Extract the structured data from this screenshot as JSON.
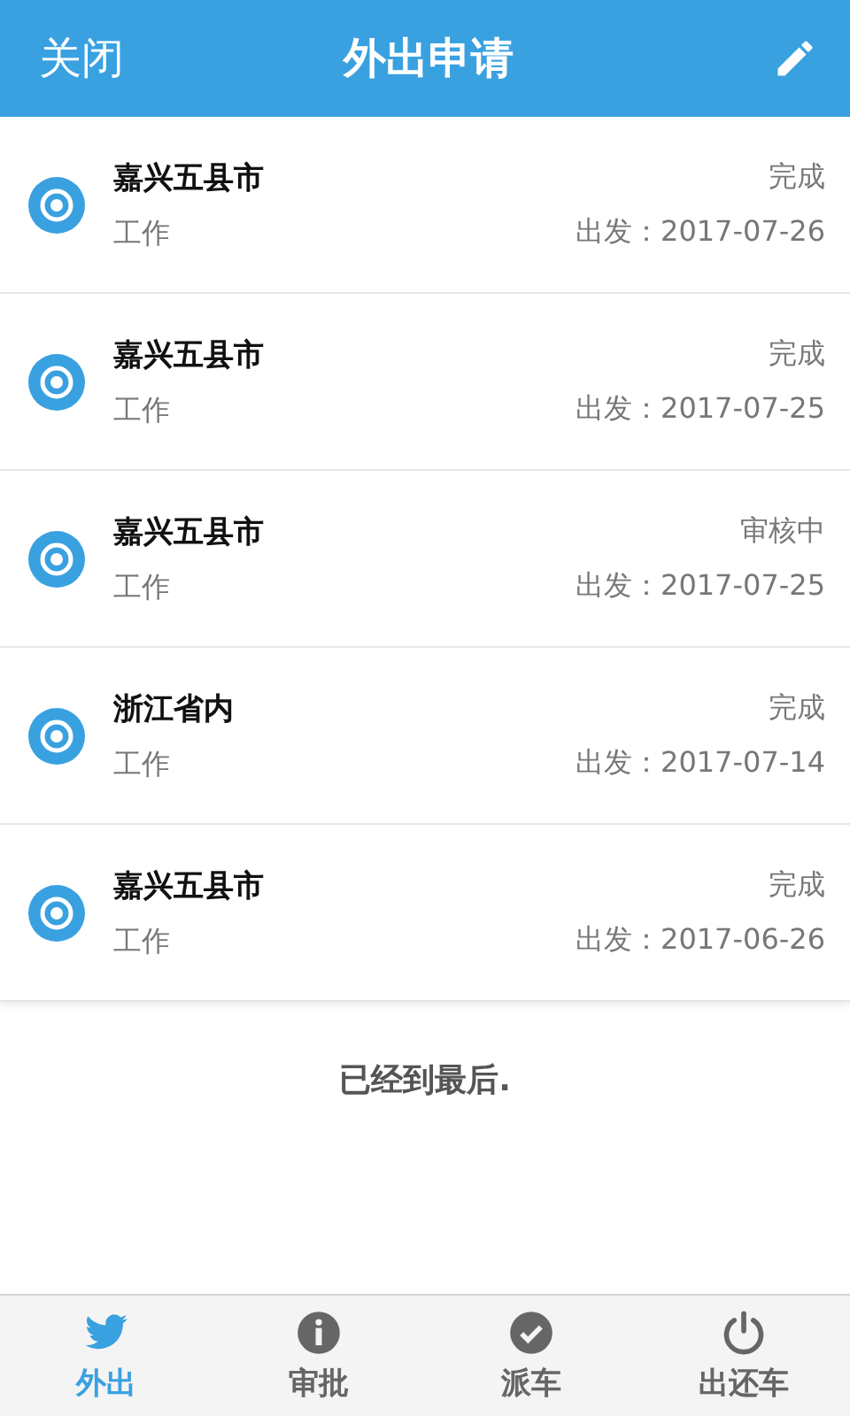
{
  "header": {
    "close": "关闭",
    "title": "外出申请"
  },
  "items": [
    {
      "destination": "嘉兴五县市",
      "type": "工作",
      "status": "完成",
      "departure": "出发：2017-07-26"
    },
    {
      "destination": "嘉兴五县市",
      "type": "工作",
      "status": "完成",
      "departure": "出发：2017-07-25"
    },
    {
      "destination": "嘉兴五县市",
      "type": "工作",
      "status": "审核中",
      "departure": "出发：2017-07-25"
    },
    {
      "destination": "浙江省内",
      "type": "工作",
      "status": "完成",
      "departure": "出发：2017-07-14"
    },
    {
      "destination": "嘉兴五县市",
      "type": "工作",
      "status": "完成",
      "departure": "出发：2017-06-26"
    }
  ],
  "end_note": "已经到最后.",
  "tabs": [
    {
      "kind": "bird",
      "label": "外出",
      "selected": true
    },
    {
      "kind": "info",
      "label": "审批",
      "selected": false
    },
    {
      "kind": "check",
      "label": "派车",
      "selected": false
    },
    {
      "kind": "power",
      "label": "出还车",
      "selected": false
    }
  ]
}
